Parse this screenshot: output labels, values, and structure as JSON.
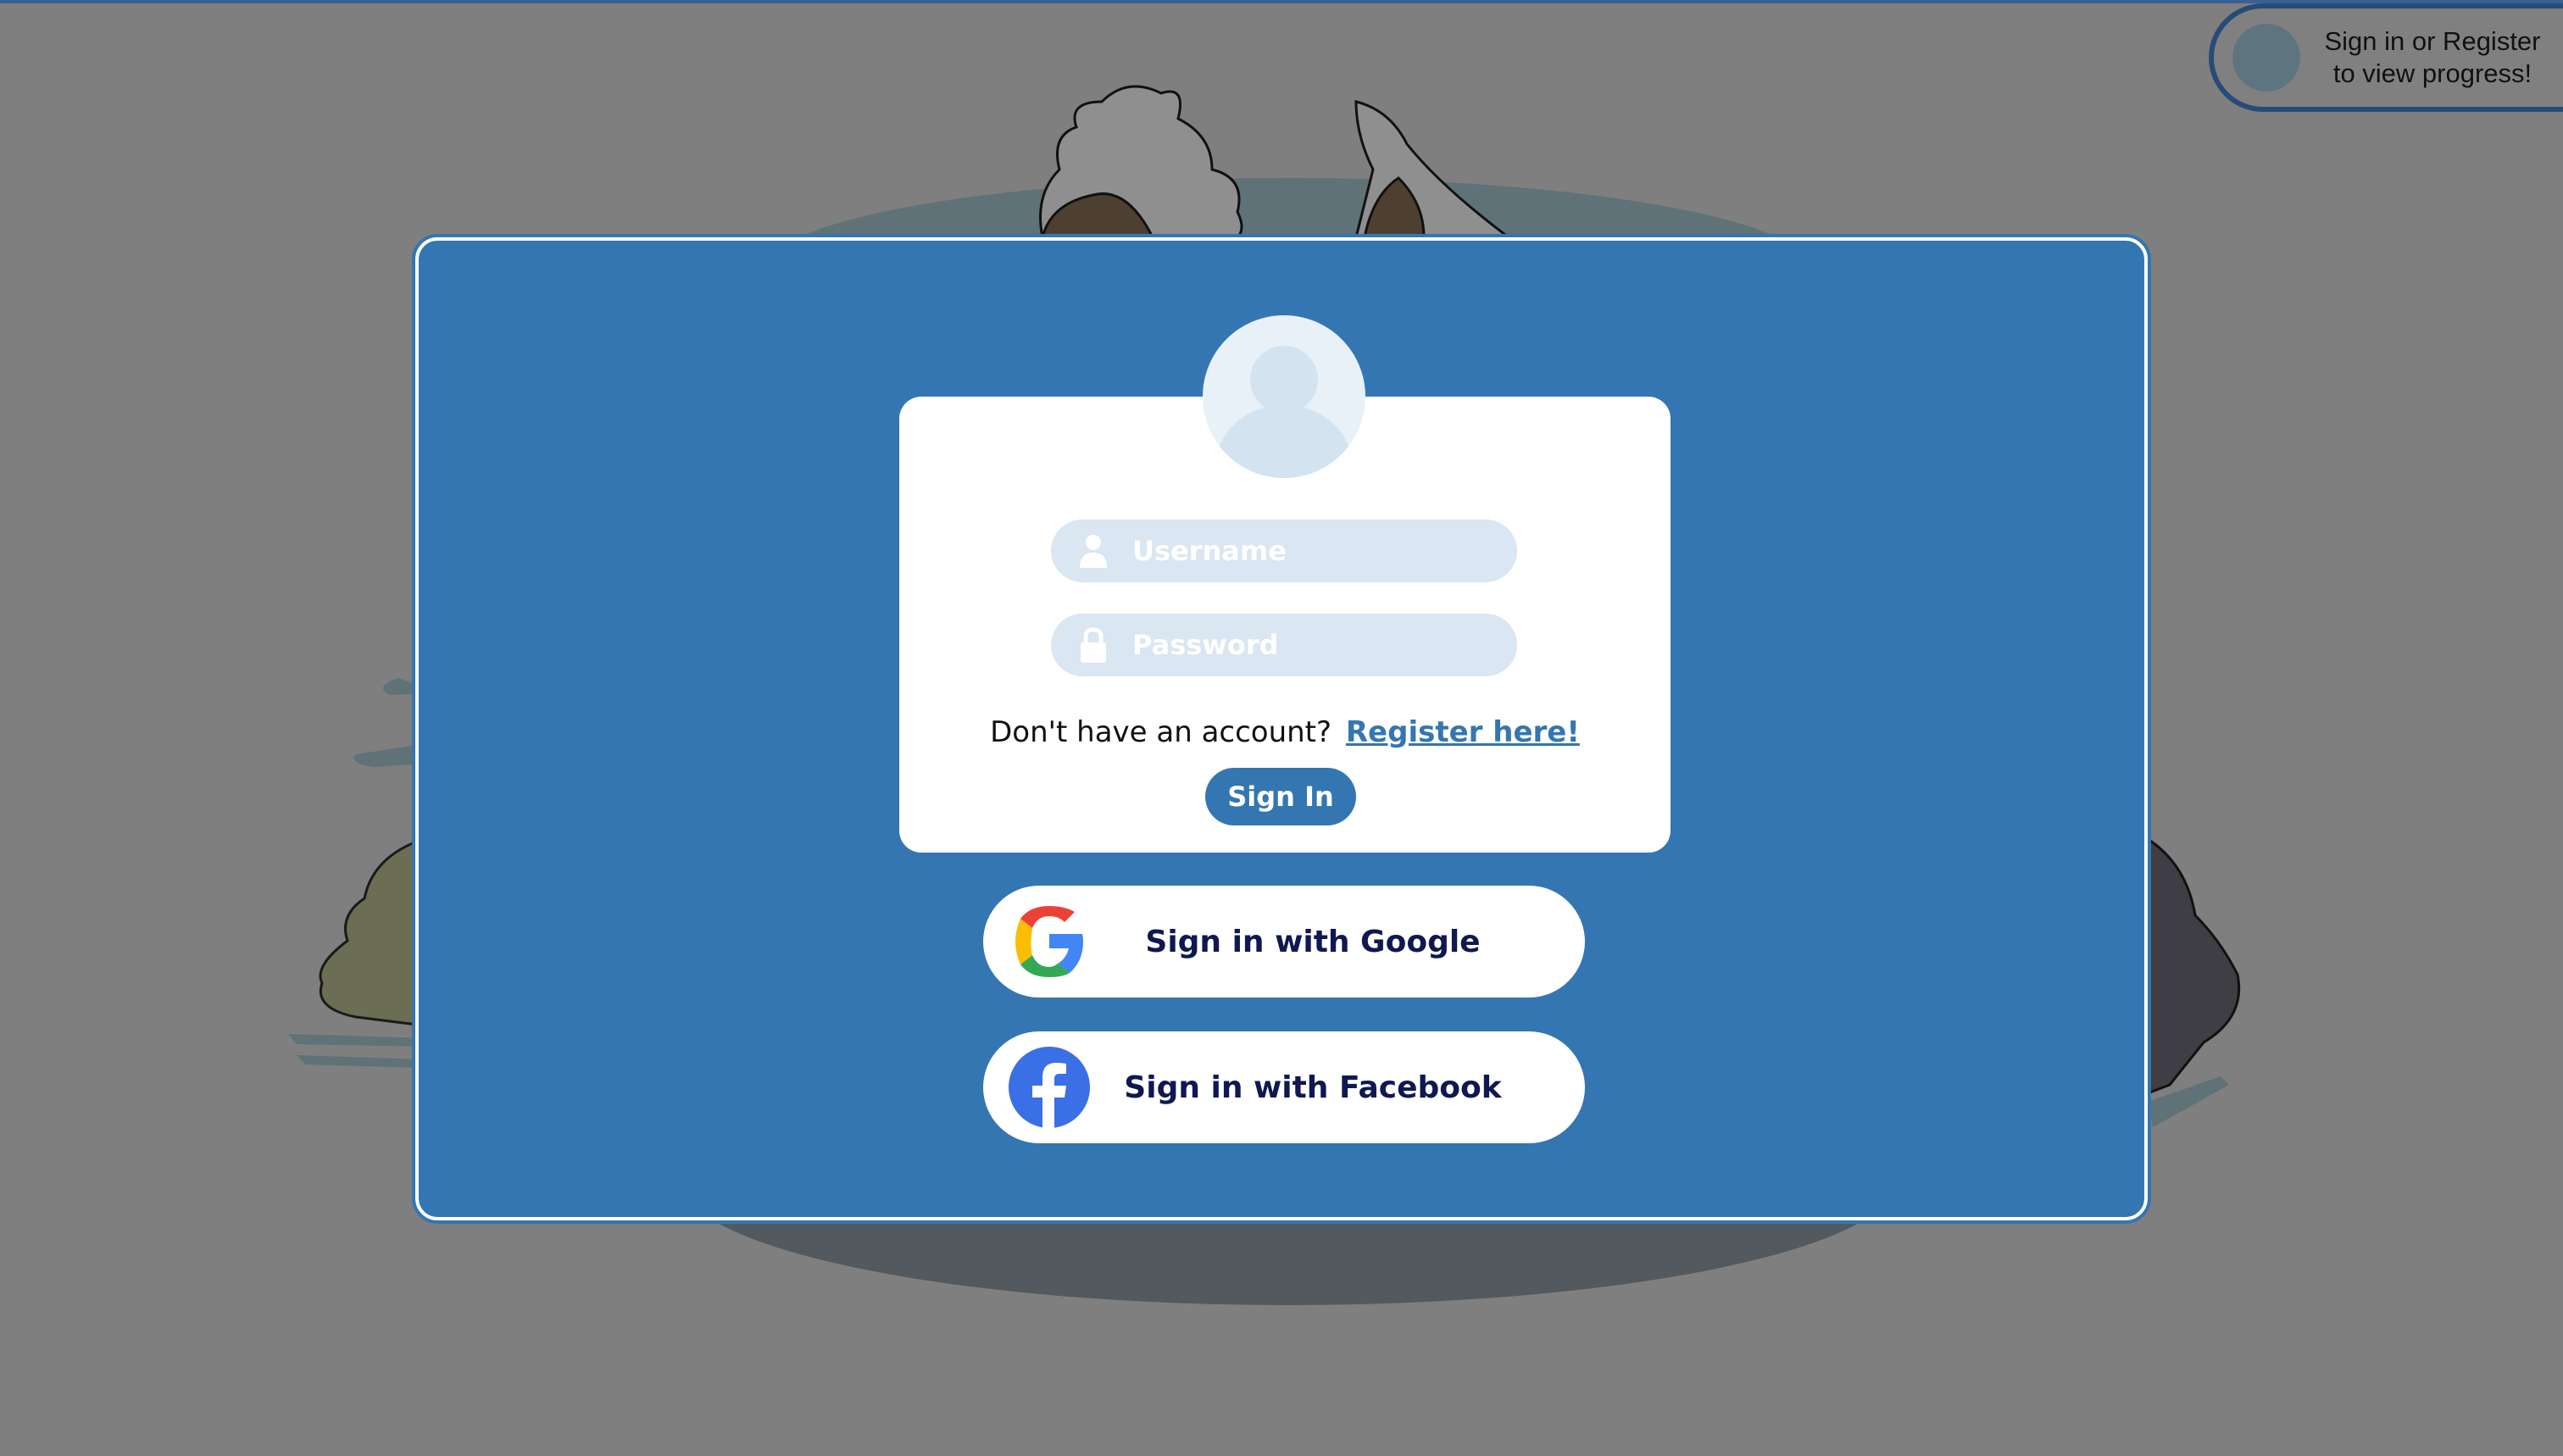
{
  "progress": {
    "line1": "Sign in or Register",
    "line2": "to view progress!"
  },
  "login": {
    "username_placeholder": "Username",
    "password_placeholder": "Password",
    "register_prompt": "Don't have an account?",
    "register_link": "Register here!",
    "signin_label": "Sign In"
  },
  "social": {
    "google_label": "Sign in with Google",
    "facebook_label": "Sign in with Facebook"
  },
  "icons": {
    "avatar": "user-avatar-icon",
    "username": "user-icon",
    "password": "lock-icon",
    "google": "google-logo-icon",
    "facebook": "facebook-logo-icon"
  },
  "colors": {
    "modal_bg": "#3476b1",
    "card_bg": "#ffffff",
    "field_bg": "#dae6f1",
    "link": "#3476b1",
    "social_text": "#0f1850",
    "overlay": "#7f7f7f"
  }
}
